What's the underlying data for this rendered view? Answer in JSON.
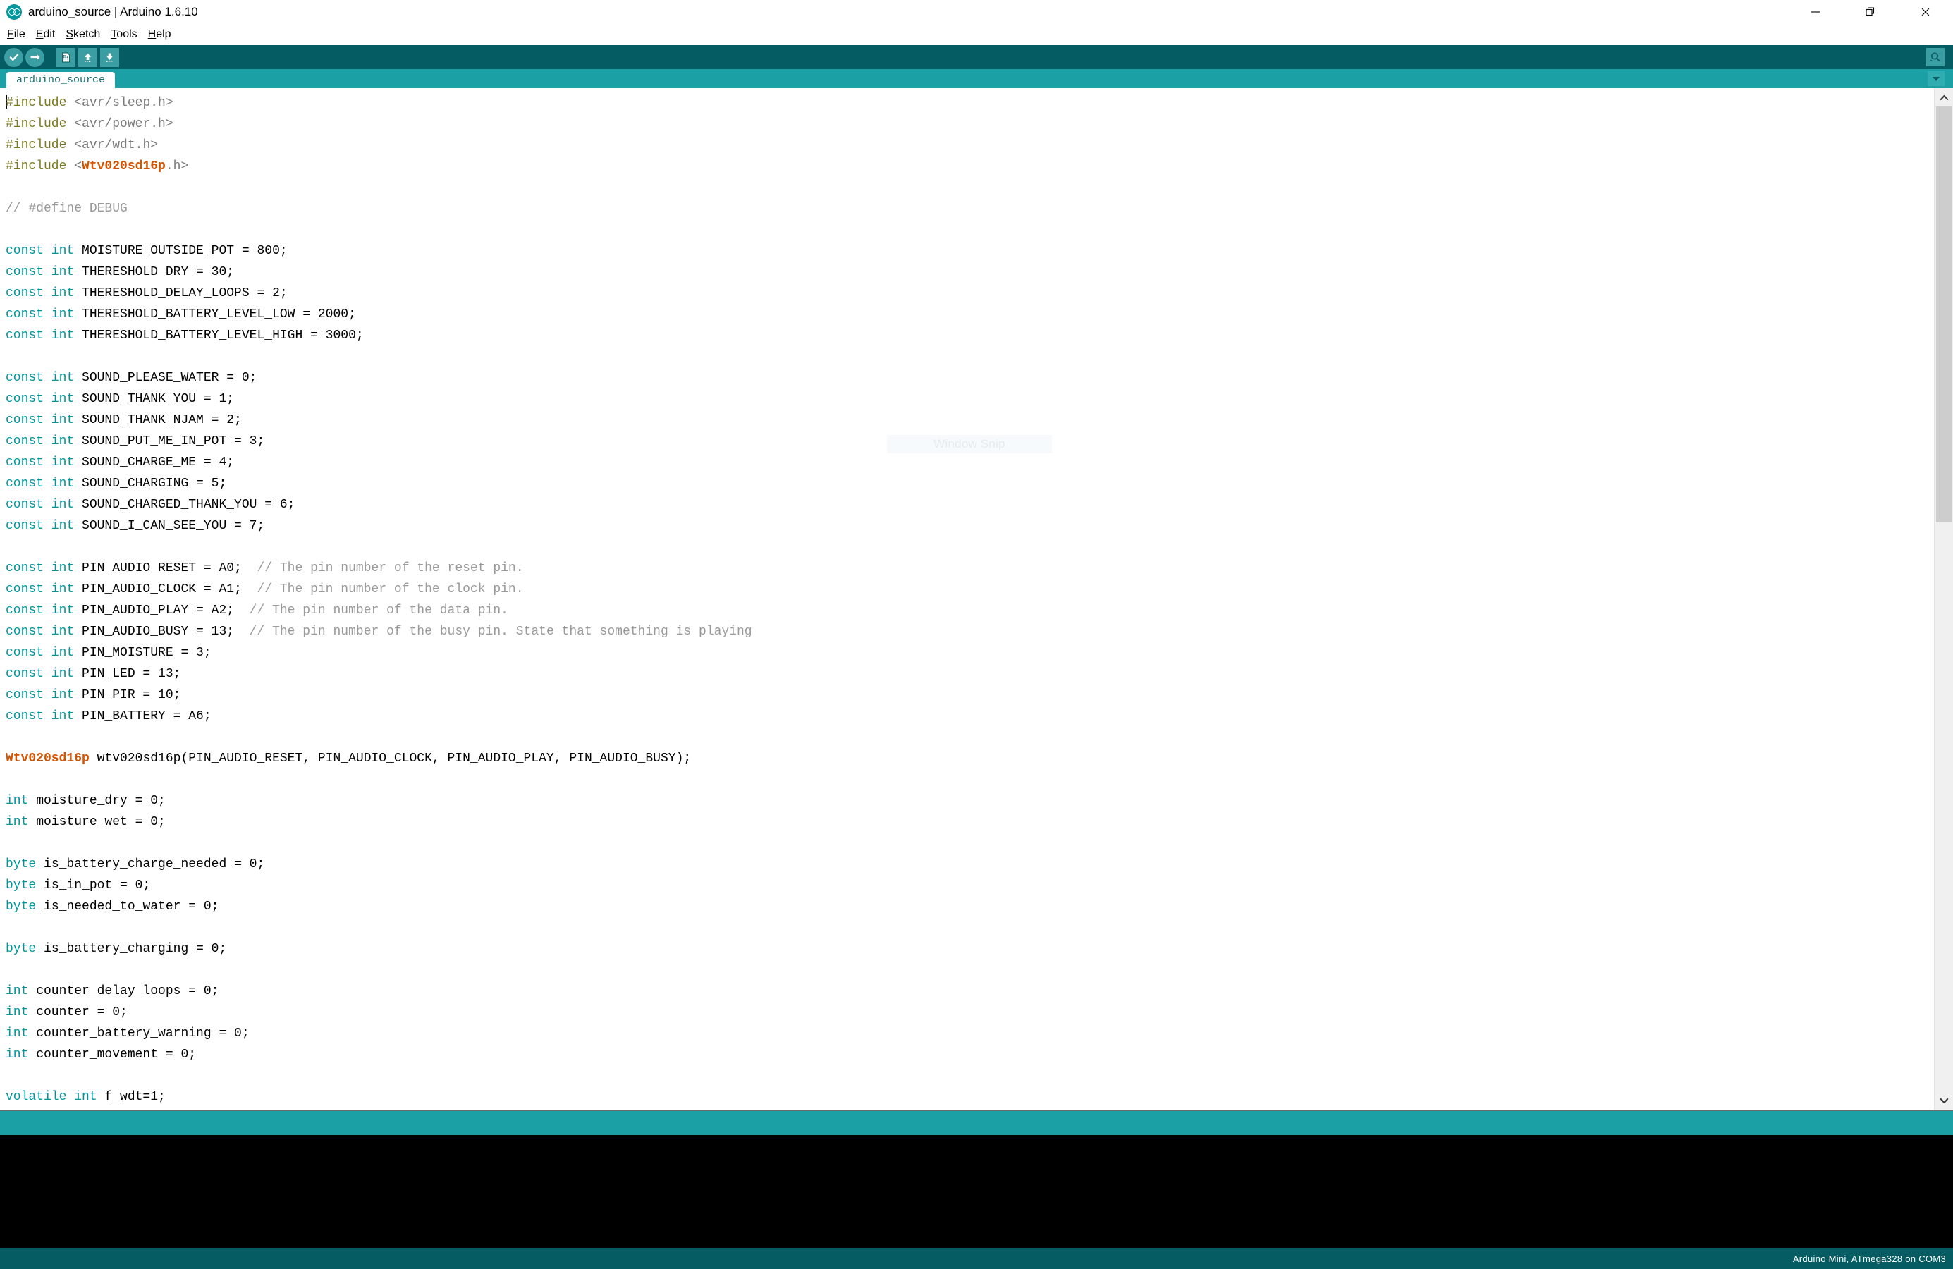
{
  "window": {
    "title": "arduino_source | Arduino 1.6.10",
    "logo_icon": "arduino-infinity-logo",
    "controls": [
      {
        "name": "minimize",
        "icon": "minimize-icon",
        "glyph": "—"
      },
      {
        "name": "restore",
        "icon": "restore-icon",
        "glyph": "❐"
      },
      {
        "name": "close",
        "icon": "close-icon",
        "glyph": "✕"
      }
    ]
  },
  "menubar": {
    "items": [
      {
        "mnemonic": "F",
        "rest": "ile"
      },
      {
        "mnemonic": "E",
        "rest": "dit"
      },
      {
        "mnemonic": "S",
        "rest": "ketch"
      },
      {
        "mnemonic": "T",
        "rest": "ools"
      },
      {
        "mnemonic": "H",
        "rest": "elp"
      }
    ]
  },
  "toolbar": {
    "buttons": [
      {
        "name": "verify-compile-button",
        "icon": "check-icon",
        "tooltip": "Verify"
      },
      {
        "name": "upload-button",
        "icon": "arrow-right-icon",
        "tooltip": "Upload"
      },
      {
        "name": "new-sketch-button",
        "icon": "new-document-icon",
        "tooltip": "New"
      },
      {
        "name": "open-sketch-button",
        "icon": "arrow-up-icon",
        "tooltip": "Open"
      },
      {
        "name": "save-sketch-button",
        "icon": "arrow-down-icon",
        "tooltip": "Save"
      }
    ],
    "serial_monitor": {
      "name": "serial-monitor-button",
      "icon": "magnifier-icon",
      "tooltip": "Serial Monitor"
    }
  },
  "tabs": {
    "active": "arduino_source",
    "items": [
      "arduino_source"
    ],
    "dropdown_icon": "chevron-down-icon"
  },
  "overlay": {
    "snip_label": "Window Snip"
  },
  "scrollbar": {
    "up_icon": "chevron-up-icon",
    "down_icon": "chevron-down-icon"
  },
  "statusbar": {
    "board_info": "Arduino Mini, ATmega328 on COM3"
  },
  "editor": {
    "lines": [
      [
        {
          "t": "pre",
          "v": "#include"
        },
        {
          "t": "str",
          "v": " <avr/sleep.h>"
        }
      ],
      [
        {
          "t": "pre",
          "v": "#include"
        },
        {
          "t": "str",
          "v": " <avr/power.h>"
        }
      ],
      [
        {
          "t": "pre",
          "v": "#include"
        },
        {
          "t": "str",
          "v": " <avr/wdt.h>"
        }
      ],
      [
        {
          "t": "pre",
          "v": "#include"
        },
        {
          "t": "str",
          "v": " <"
        },
        {
          "t": "lib",
          "v": "Wtv020sd16p"
        },
        {
          "t": "str",
          "v": ".h>"
        }
      ],
      [],
      [
        {
          "t": "cmt",
          "v": "// #define DEBUG"
        }
      ],
      [],
      [
        {
          "t": "kw",
          "v": "const int"
        },
        {
          "t": "txt",
          "v": " MOISTURE_OUTSIDE_POT = 800;"
        }
      ],
      [
        {
          "t": "kw",
          "v": "const int"
        },
        {
          "t": "txt",
          "v": " THERESHOLD_DRY = 30;"
        }
      ],
      [
        {
          "t": "kw",
          "v": "const int"
        },
        {
          "t": "txt",
          "v": " THERESHOLD_DELAY_LOOPS = 2;"
        }
      ],
      [
        {
          "t": "kw",
          "v": "const int"
        },
        {
          "t": "txt",
          "v": " THERESHOLD_BATTERY_LEVEL_LOW = 2000;"
        }
      ],
      [
        {
          "t": "kw",
          "v": "const int"
        },
        {
          "t": "txt",
          "v": " THERESHOLD_BATTERY_LEVEL_HIGH = 3000;"
        }
      ],
      [],
      [
        {
          "t": "kw",
          "v": "const int"
        },
        {
          "t": "txt",
          "v": " SOUND_PLEASE_WATER = 0;"
        }
      ],
      [
        {
          "t": "kw",
          "v": "const int"
        },
        {
          "t": "txt",
          "v": " SOUND_THANK_YOU = 1;"
        }
      ],
      [
        {
          "t": "kw",
          "v": "const int"
        },
        {
          "t": "txt",
          "v": " SOUND_THANK_NJAM = 2;"
        }
      ],
      [
        {
          "t": "kw",
          "v": "const int"
        },
        {
          "t": "txt",
          "v": " SOUND_PUT_ME_IN_POT = 3;"
        }
      ],
      [
        {
          "t": "kw",
          "v": "const int"
        },
        {
          "t": "txt",
          "v": " SOUND_CHARGE_ME = 4;"
        }
      ],
      [
        {
          "t": "kw",
          "v": "const int"
        },
        {
          "t": "txt",
          "v": " SOUND_CHARGING = 5;"
        }
      ],
      [
        {
          "t": "kw",
          "v": "const int"
        },
        {
          "t": "txt",
          "v": " SOUND_CHARGED_THANK_YOU = 6;"
        }
      ],
      [
        {
          "t": "kw",
          "v": "const int"
        },
        {
          "t": "txt",
          "v": " SOUND_I_CAN_SEE_YOU = 7;"
        }
      ],
      [],
      [
        {
          "t": "kw",
          "v": "const int"
        },
        {
          "t": "txt",
          "v": " PIN_AUDIO_RESET = A0;  "
        },
        {
          "t": "cmt",
          "v": "// The pin number of the reset pin."
        }
      ],
      [
        {
          "t": "kw",
          "v": "const int"
        },
        {
          "t": "txt",
          "v": " PIN_AUDIO_CLOCK = A1;  "
        },
        {
          "t": "cmt",
          "v": "// The pin number of the clock pin."
        }
      ],
      [
        {
          "t": "kw",
          "v": "const int"
        },
        {
          "t": "txt",
          "v": " PIN_AUDIO_PLAY = A2;  "
        },
        {
          "t": "cmt",
          "v": "// The pin number of the data pin."
        }
      ],
      [
        {
          "t": "kw",
          "v": "const int"
        },
        {
          "t": "txt",
          "v": " PIN_AUDIO_BUSY = 13;  "
        },
        {
          "t": "cmt",
          "v": "// The pin number of the busy pin. State that something is playing"
        }
      ],
      [
        {
          "t": "kw",
          "v": "const int"
        },
        {
          "t": "txt",
          "v": " PIN_MOISTURE = 3;"
        }
      ],
      [
        {
          "t": "kw",
          "v": "const int"
        },
        {
          "t": "txt",
          "v": " PIN_LED = 13;"
        }
      ],
      [
        {
          "t": "kw",
          "v": "const int"
        },
        {
          "t": "txt",
          "v": " PIN_PIR = 10;"
        }
      ],
      [
        {
          "t": "kw",
          "v": "const int"
        },
        {
          "t": "txt",
          "v": " PIN_BATTERY = A6;"
        }
      ],
      [],
      [
        {
          "t": "lib",
          "v": "Wtv020sd16p"
        },
        {
          "t": "txt",
          "v": " wtv020sd16p(PIN_AUDIO_RESET, PIN_AUDIO_CLOCK, PIN_AUDIO_PLAY, PIN_AUDIO_BUSY);"
        }
      ],
      [],
      [
        {
          "t": "kw",
          "v": "int"
        },
        {
          "t": "txt",
          "v": " moisture_dry = 0;"
        }
      ],
      [
        {
          "t": "kw",
          "v": "int"
        },
        {
          "t": "txt",
          "v": " moisture_wet = 0;"
        }
      ],
      [],
      [
        {
          "t": "kw",
          "v": "byte"
        },
        {
          "t": "txt",
          "v": " is_battery_charge_needed = 0;"
        }
      ],
      [
        {
          "t": "kw",
          "v": "byte"
        },
        {
          "t": "txt",
          "v": " is_in_pot = 0;"
        }
      ],
      [
        {
          "t": "kw",
          "v": "byte"
        },
        {
          "t": "txt",
          "v": " is_needed_to_water = 0;"
        }
      ],
      [],
      [
        {
          "t": "kw",
          "v": "byte"
        },
        {
          "t": "txt",
          "v": " is_battery_charging = 0;"
        }
      ],
      [],
      [
        {
          "t": "kw",
          "v": "int"
        },
        {
          "t": "txt",
          "v": " counter_delay_loops = 0;"
        }
      ],
      [
        {
          "t": "kw",
          "v": "int"
        },
        {
          "t": "txt",
          "v": " counter = 0;"
        }
      ],
      [
        {
          "t": "kw",
          "v": "int"
        },
        {
          "t": "txt",
          "v": " counter_battery_warning = 0;"
        }
      ],
      [
        {
          "t": "kw",
          "v": "int"
        },
        {
          "t": "txt",
          "v": " counter_movement = 0;"
        }
      ],
      [],
      [
        {
          "t": "kw",
          "v": "volatile int"
        },
        {
          "t": "txt",
          "v": " f_wdt=1;"
        }
      ]
    ]
  }
}
